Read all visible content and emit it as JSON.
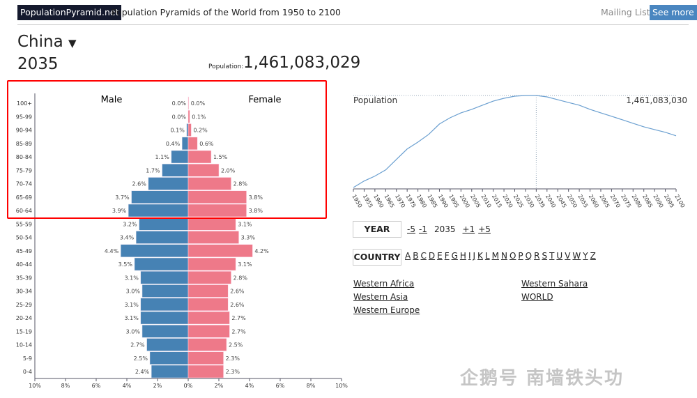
{
  "header": {
    "brand": "PopulationPyramid.net",
    "tagline": "Population Pyramids of the World from 1950 to 2100",
    "mailing_list": "Mailing List -",
    "see_more": "See more"
  },
  "country": {
    "name": "China",
    "dropdown_icon": "▼"
  },
  "year": "2035",
  "population": {
    "label": "Population:",
    "value": "1,461,083,029"
  },
  "annotation_color": "#ff0000",
  "pyramid": {
    "type": "bar",
    "orientation": "horizontal-population-pyramid",
    "male_label": "Male",
    "female_label": "Female",
    "colors": {
      "male": "#4682b4",
      "female": "#ee7989"
    },
    "age_groups": [
      "100+",
      "95-99",
      "90-94",
      "85-89",
      "80-84",
      "75-79",
      "70-74",
      "65-69",
      "60-64",
      "55-59",
      "50-54",
      "45-49",
      "40-44",
      "35-39",
      "30-34",
      "25-29",
      "20-24",
      "15-19",
      "10-14",
      "5-9",
      "0-4"
    ],
    "male": [
      0.0,
      0.0,
      0.1,
      0.4,
      1.1,
      1.7,
      2.6,
      3.7,
      3.9,
      3.2,
      3.4,
      4.4,
      3.5,
      3.1,
      3.0,
      3.1,
      3.1,
      3.0,
      2.7,
      2.5,
      2.4
    ],
    "female": [
      0.0,
      0.1,
      0.2,
      0.6,
      1.5,
      2.0,
      2.8,
      3.8,
      3.8,
      3.1,
      3.3,
      4.2,
      3.1,
      2.8,
      2.6,
      2.6,
      2.7,
      2.7,
      2.5,
      2.3,
      2.3
    ],
    "x_ticks": [
      "10%",
      "8%",
      "6%",
      "4%",
      "2%",
      "0%",
      "2%",
      "4%",
      "6%",
      "8%",
      "10%"
    ],
    "xlim": [
      -10,
      10
    ]
  },
  "chart_data": {
    "type": "line",
    "title": "Population",
    "highlight_label": "1,461,083,030",
    "highlight_year": 2035,
    "color": "#6a9fd0",
    "x": [
      1950,
      1955,
      1960,
      1965,
      1970,
      1975,
      1980,
      1985,
      1990,
      1995,
      2000,
      2005,
      2010,
      2015,
      2020,
      2025,
      2030,
      2035,
      2040,
      2045,
      2050,
      2055,
      2060,
      2065,
      2070,
      2075,
      2080,
      2085,
      2090,
      2095,
      2100
    ],
    "values_millions": [
      541,
      606,
      655,
      717,
      822,
      926,
      995,
      1072,
      1176,
      1239,
      1287,
      1322,
      1364,
      1405,
      1433,
      1454,
      1461,
      1461,
      1447,
      1419,
      1391,
      1364,
      1322,
      1287,
      1253,
      1218,
      1183,
      1148,
      1120,
      1093,
      1058
    ]
  },
  "controls": {
    "year_button": "YEAR",
    "year_nav": [
      "-5",
      "-1",
      "2035",
      "+1",
      "+5"
    ],
    "country_button": "COUNTRY",
    "letters": [
      "A",
      "B",
      "C",
      "D",
      "E",
      "F",
      "G",
      "H",
      "I",
      "J",
      "K",
      "L",
      "M",
      "N",
      "O",
      "P",
      "Q",
      "R",
      "S",
      "T",
      "U",
      "V",
      "W",
      "Y",
      "Z"
    ],
    "regions": [
      "Western Africa",
      "Western Asia",
      "Western Europe",
      "Western Sahara",
      "WORLD"
    ]
  },
  "watermark": "企鹅号 南墙铁头功"
}
